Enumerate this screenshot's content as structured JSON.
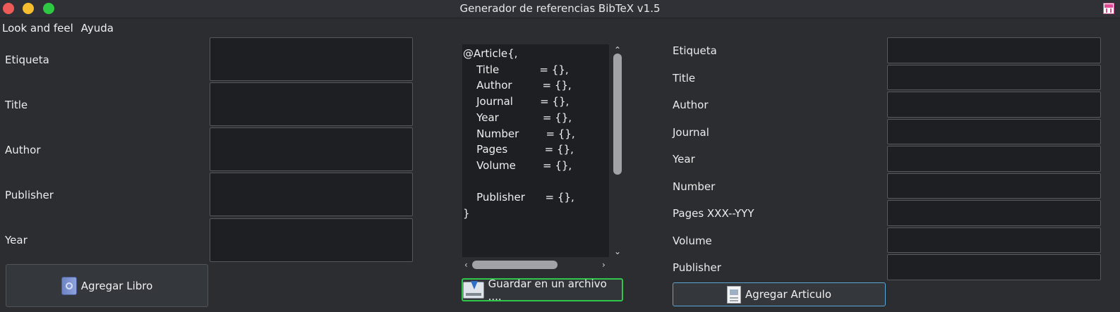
{
  "window": {
    "title": "Generador de referencias BibTeX v1.5"
  },
  "menu": [
    "Look and feel",
    "Ayuda"
  ],
  "book_form": {
    "labels": [
      "Etiqueta",
      "Title",
      "Author",
      "Publisher",
      "Year"
    ],
    "button_label": "Agregar Libro"
  },
  "preview": {
    "text": "@Article{,\n    Title            = {},\n    Author         = {},\n    Journal        = {},\n    Year             = {},\n    Number        = {},\n    Pages           = {},\n    Volume        = {},\n\n    Publisher      = {},\n}",
    "save_button_label": "Guardar en un archivo ...."
  },
  "article_form": {
    "labels": [
      "Etiqueta",
      "Title",
      "Author",
      "Journal",
      "Year",
      "Number",
      "Pages XXX--YYY",
      "Volume",
      "Publisher"
    ],
    "button_label": "Agregar Articulo"
  },
  "icons": {
    "book_button": "book-icon",
    "save_button": "save-download-icon",
    "article_button": "document-icon",
    "scroll_up": "chevron-up-icon",
    "scroll_down": "chevron-down-icon",
    "scroll_left": "chevron-left-icon",
    "scroll_right": "chevron-right-icon"
  },
  "colors": {
    "background": "#2b2d30",
    "field_background": "#1e1f22",
    "save_button_border": "#2fc64a",
    "article_button_border": "#5aa7d6"
  }
}
